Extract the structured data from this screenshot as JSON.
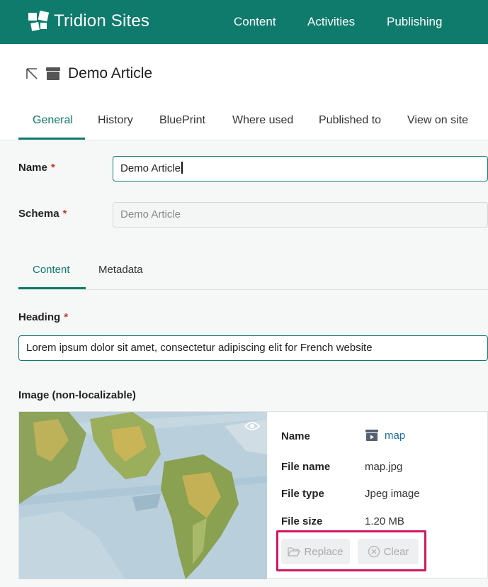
{
  "app": {
    "brand": "Tridion Sites"
  },
  "top_nav": [
    "Content",
    "Activities",
    "Publishing"
  ],
  "page": {
    "title": "Demo Article"
  },
  "tabs": [
    "General",
    "History",
    "BluePrint",
    "Where used",
    "Published to",
    "View on site"
  ],
  "form": {
    "name": {
      "label": "Name",
      "value": "Demo Article"
    },
    "schema": {
      "label": "Schema",
      "value": "Demo Article"
    },
    "subtabs": [
      "Content",
      "Metadata"
    ],
    "heading": {
      "label": "Heading",
      "value": "Lorem ipsum dolor sit amet, consectetur adipiscing elit for French website"
    },
    "image": {
      "label": "Image (non-localizable)",
      "name_label": "Name",
      "name_value": "map",
      "file_name_label": "File name",
      "file_name_value": "map.jpg",
      "file_type_label": "File type",
      "file_type_value": "Jpeg image",
      "file_size_label": "File size",
      "file_size_value": "1.20 MB"
    },
    "required_marker": "*",
    "buttons": {
      "replace": "Replace",
      "clear": "Clear"
    }
  },
  "colors": {
    "accent": "#0f7b6c",
    "header": "#0f7b6c",
    "highlight": "#d1175f",
    "link": "#1d6ea0",
    "required": "#c0392b"
  }
}
